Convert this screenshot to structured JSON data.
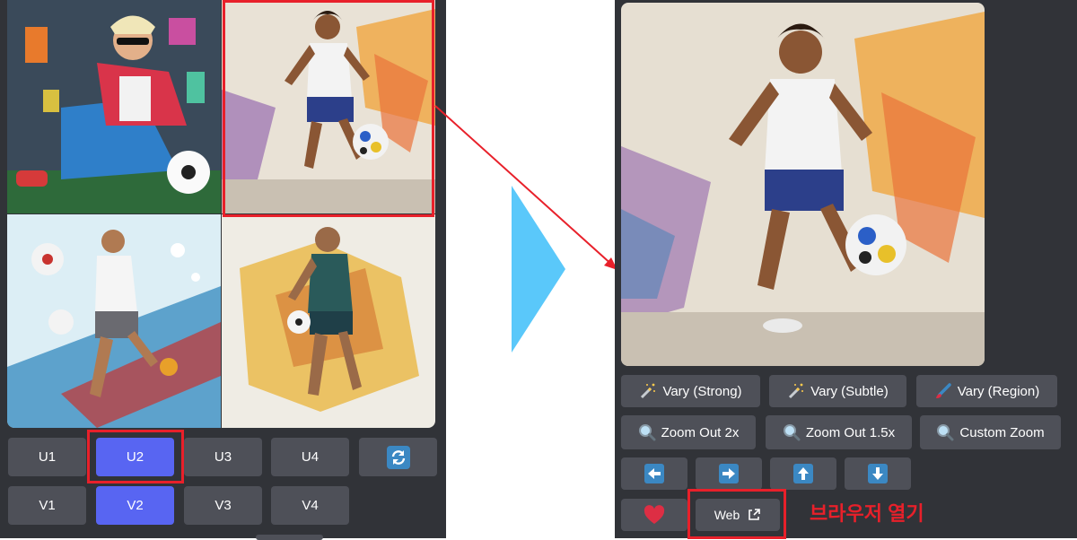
{
  "left_grid": {
    "images": [
      {
        "alt": "Blonde player with sunglasses sitting with soccer ball"
      },
      {
        "alt": "Soccer player dribbling ball, selected"
      },
      {
        "alt": "Player kicking ball with colorful splashes"
      },
      {
        "alt": "Player in green jersey running with ball"
      }
    ],
    "upscale_buttons": [
      "U1",
      "U2",
      "U3",
      "U4"
    ],
    "variation_buttons": [
      "V1",
      "V2",
      "V3",
      "V4"
    ],
    "reroll_icon": "refresh-icon",
    "active_buttons": [
      "U2",
      "V2"
    ]
  },
  "right_result": {
    "image_alt": "Upscaled soccer player dribbling ball",
    "vary_buttons": [
      "Vary (Strong)",
      "Vary (Subtle)",
      "Vary (Region)"
    ],
    "zoom_buttons": [
      "Zoom Out 2x",
      "Zoom Out 1.5x",
      "Custom Zoom"
    ],
    "pan_icons": [
      "arrow-left-icon",
      "arrow-right-icon",
      "arrow-up-icon",
      "arrow-down-icon"
    ],
    "favorite_icon": "heart-icon",
    "web_label": "Web"
  },
  "annotation": {
    "callout_text": "브라우저 열기"
  },
  "colors": {
    "panel_bg": "#313338",
    "button_bg": "#4e5058",
    "button_active": "#5865f2",
    "highlight": "#e8202a",
    "flow_arrow": "#5ac8fa",
    "heart": "#dd2e44"
  }
}
